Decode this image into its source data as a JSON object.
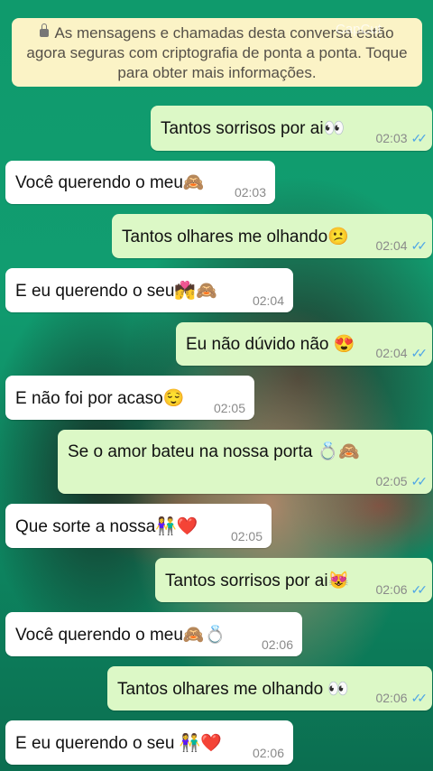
{
  "encryption_notice": "As mensagens e chamadas desta conversa estão agora seguras com criptografia de ponta a ponta. Toque para obter mais informações.",
  "watermark": "CapCut",
  "read_receipt": "✓✓",
  "colors": {
    "outgoing": "#dcf8c6",
    "incoming": "#ffffff",
    "notice": "#fbf3c6",
    "read_ticks": "#4fa6e6"
  },
  "messages": [
    {
      "dir": "out",
      "text": "Tantos sorrisos por ai👀",
      "time": "02:03",
      "read": true
    },
    {
      "dir": "in",
      "text": "Você querendo o meu🙈",
      "time": "02:03"
    },
    {
      "dir": "out",
      "text": "Tantos olhares me olhando😕",
      "time": "02:04",
      "read": true
    },
    {
      "dir": "in",
      "text": "E eu querendo o seu💏🙈",
      "time": "02:04"
    },
    {
      "dir": "out",
      "text": "Eu não dúvido não 😍",
      "time": "02:04",
      "read": true
    },
    {
      "dir": "in",
      "text": "E não foi por acaso😌",
      "time": "02:05"
    },
    {
      "dir": "out",
      "text": "Se o amor bateu na nossa porta 💍🙈",
      "time": "02:05",
      "read": true
    },
    {
      "dir": "in",
      "text": "Que sorte a nossa👫❤️",
      "time": "02:05"
    },
    {
      "dir": "out",
      "text": "Tantos sorrisos por ai😻",
      "time": "02:06",
      "read": true
    },
    {
      "dir": "in",
      "text": "Você querendo o meu🙈💍",
      "time": "02:06"
    },
    {
      "dir": "out",
      "text": "Tantos olhares me olhando 👀",
      "time": "02:06",
      "read": true
    },
    {
      "dir": "in",
      "text": "E eu querendo o seu 👫❤️",
      "time": "02:06"
    }
  ]
}
